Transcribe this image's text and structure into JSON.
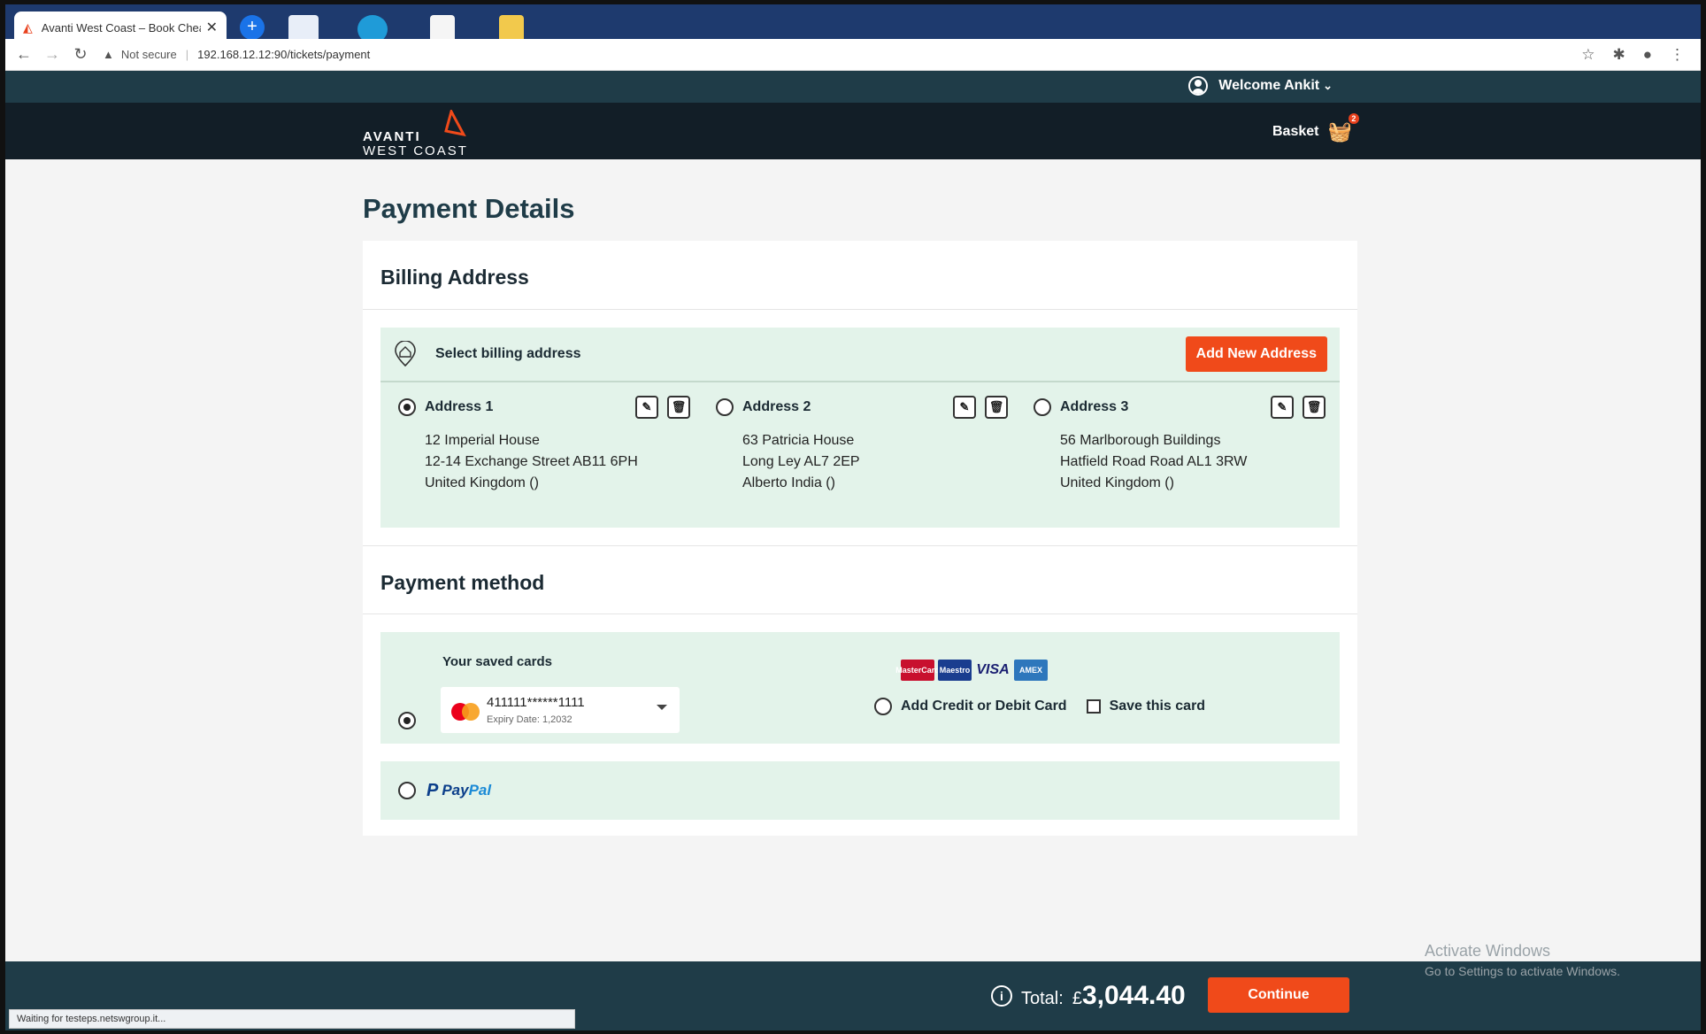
{
  "browser": {
    "tab_title": "Avanti West Coast – Book Cheap",
    "security": "Not secure",
    "url": "192.168.12.12:90/tickets/payment",
    "status_text": "Waiting for testeps.netswgroup.it..."
  },
  "header": {
    "welcome": "Welcome Ankit",
    "logo_line1": "AVANTI",
    "logo_line2": "WEST COAST",
    "basket_label": "Basket",
    "basket_count": "2"
  },
  "page": {
    "title": "Payment Details"
  },
  "billing": {
    "heading": "Billing Address",
    "select_label": "Select billing address",
    "add_button": "Add New Address",
    "addresses": [
      {
        "name": "Address 1",
        "line1": "12 Imperial House",
        "line2": "12-14 Exchange Street AB11 6PH",
        "line3": "United Kingdom ()",
        "selected": true
      },
      {
        "name": "Address 2",
        "line1": "63 Patricia House",
        "line2": "Long Ley AL7 2EP",
        "line3": "Alberto India ()",
        "selected": false
      },
      {
        "name": "Address 3",
        "line1": "56 Marlborough Buildings",
        "line2": "Hatfield Road Road AL1 3RW",
        "line3": "United Kingdom ()",
        "selected": false
      }
    ]
  },
  "payment": {
    "heading": "Payment method",
    "saved_cards_label": "Your saved cards",
    "card_number": "411111******1111",
    "card_expiry": "Expiry Date: 1,2032",
    "card_logos": [
      "MasterCard",
      "Maestro",
      "VISA",
      "AMEX"
    ],
    "add_card_label": "Add Credit or Debit Card",
    "save_card_label": "Save this card",
    "paypal_label_a": "Pay",
    "paypal_label_b": "Pal"
  },
  "footer": {
    "total_label": "Total:",
    "currency": "£",
    "total_amount": "3,044.40",
    "continue_button": "Continue"
  },
  "watermark": {
    "line1": "Activate Windows",
    "line2": "Go to Settings to activate Windows."
  },
  "colors": {
    "accent": "#f04a1a",
    "header_dark": "#121e27",
    "header_teal": "#1f3c48",
    "panel_green": "#e3f3ea"
  }
}
